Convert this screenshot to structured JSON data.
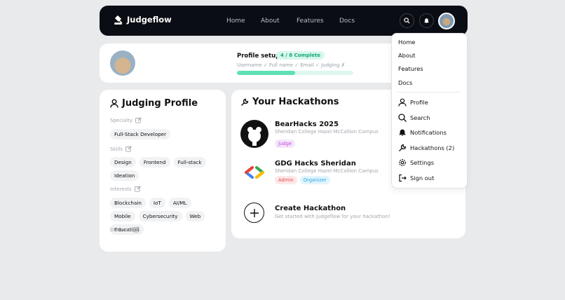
{
  "brand": {
    "name": "Judgeflow"
  },
  "nav": {
    "links": [
      "Home",
      "About",
      "Features",
      "Docs"
    ]
  },
  "setup": {
    "title": "Profile setup",
    "progress_label": "4 / 8 Complete",
    "progress_fraction": 0.5,
    "steps": "Username ✓  Full name ✓  Email ✓  Judging ✗"
  },
  "judging": {
    "title": "Judging Profile",
    "specialty_label": "Specialty",
    "specialty": [
      "Full-Stack Developer"
    ],
    "skills_label": "Skills",
    "skills": [
      "Design",
      "Frontend",
      "Full-stack",
      "Ideation"
    ],
    "interests_label": "Interests",
    "interests": [
      "Blockchain",
      "IoT",
      "AI/ML",
      "Mobile",
      "Cybersecurity",
      "Web",
      "Education"
    ],
    "devpost_label": "Devpost"
  },
  "hackathons": {
    "title": "Your Hackathons",
    "items": [
      {
        "name": "BearHacks 2025",
        "campus": "Sheridan College Hazel McCallion Campus",
        "roles": [
          "Judge"
        ]
      },
      {
        "name": "GDG Hacks Sheridan",
        "campus": "Sheridan College Hazel McCallion Campus",
        "roles": [
          "Admin",
          "Organizer"
        ]
      }
    ],
    "create_title": "Create Hackathon",
    "create_sub": "Get started with Judgeflow for your hackathon!"
  },
  "menu": {
    "top": [
      "Home",
      "About",
      "Features",
      "Docs"
    ],
    "profile": "Profile",
    "search": "Search",
    "notifications": "Notifications",
    "hackathons": "Hackathons (2)",
    "settings": "Settings",
    "signout": "Sign out"
  },
  "colors": {
    "nav": "#0b0d14",
    "accent": "#5fe0b6",
    "judge": "#c04cd6",
    "admin": "#e5484d",
    "organizer": "#2aa6e0"
  }
}
